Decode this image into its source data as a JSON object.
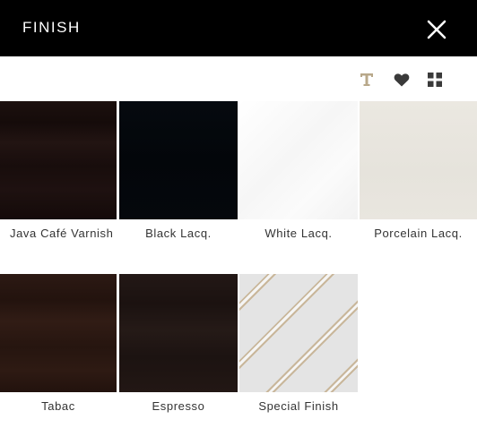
{
  "header": {
    "title": "FINISH"
  },
  "colors": {
    "header_bg": "#000000",
    "icon_gold": "#b8a88a",
    "icon_dark": "#3a3a3a"
  },
  "toolbar": {
    "icons": [
      "text-icon",
      "heart-icon",
      "grid-icon"
    ]
  },
  "finishes": [
    {
      "label": "Java Café Varnish",
      "swatch": "#1a0f0d"
    },
    {
      "label": "Black Lacq.",
      "swatch": "#05080c"
    },
    {
      "label": "White Lacq.",
      "swatch": "#f8f8f8"
    },
    {
      "label": "Porcelain Lacq.",
      "swatch": "#e8e5de"
    },
    {
      "label": "Tabac",
      "swatch": "#2a1812"
    },
    {
      "label": "Espresso",
      "swatch": "#1f1513"
    },
    {
      "label": "Special Finish",
      "swatch": "#e6e6e6"
    }
  ]
}
